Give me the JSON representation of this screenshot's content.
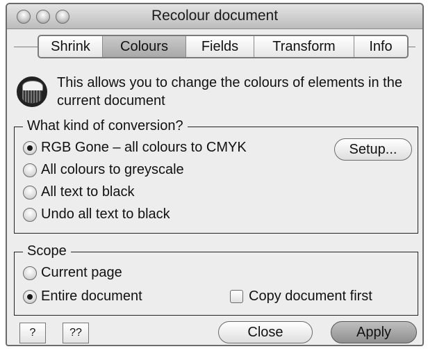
{
  "window": {
    "title": "Recolour document"
  },
  "tabs": [
    {
      "label": "Shrink",
      "selected": false
    },
    {
      "label": "Colours",
      "selected": true
    },
    {
      "label": "Fields",
      "selected": false
    },
    {
      "label": "Transform",
      "selected": false
    },
    {
      "label": "Info",
      "selected": false
    }
  ],
  "description": "This allows you to change the colours of elements in the current document",
  "conversion": {
    "legend": "What kind of conversion?",
    "options": [
      {
        "label": "RGB Gone – all colours to CMYK",
        "selected": true
      },
      {
        "label": "All colours to greyscale",
        "selected": false
      },
      {
        "label": "All text to black",
        "selected": false
      },
      {
        "label": "Undo all text to black",
        "selected": false
      }
    ],
    "setup_label": "Setup..."
  },
  "scope": {
    "legend": "Scope",
    "options": [
      {
        "label": "Current page",
        "selected": false
      },
      {
        "label": "Entire document",
        "selected": true
      }
    ],
    "copy_first_label": "Copy document first",
    "copy_first_checked": false
  },
  "footer": {
    "help_label": "?",
    "more_help_label": "??",
    "close_label": "Close",
    "apply_label": "Apply"
  },
  "icons": [
    "globe-icon"
  ]
}
